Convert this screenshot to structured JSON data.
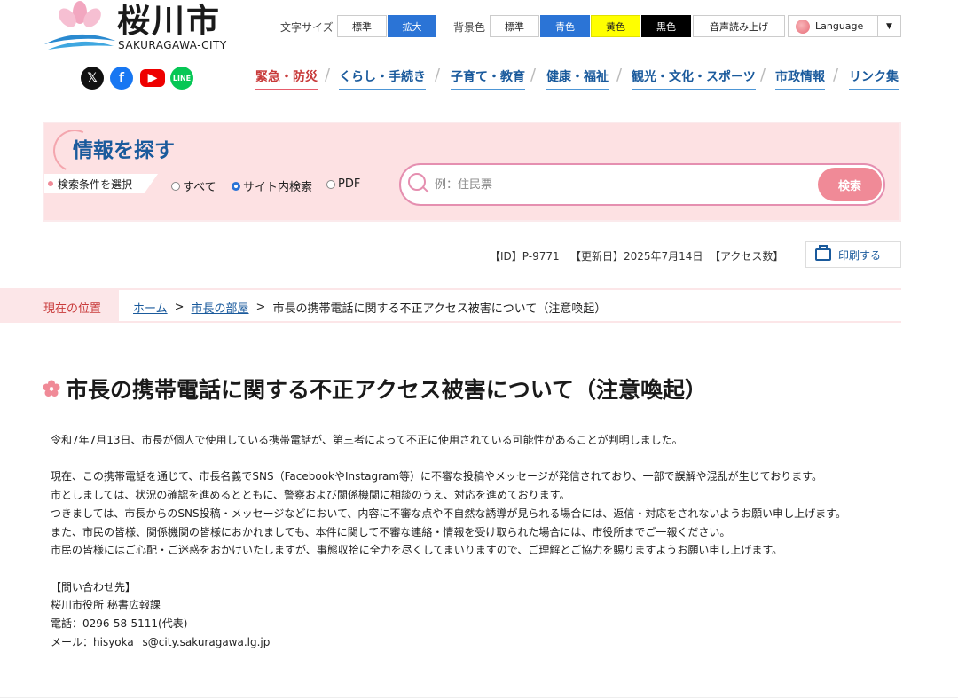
{
  "header": {
    "logo_title": "桜川市",
    "logo_sub": "SAKURAGAWA-CITY",
    "font_size_label": "文字サイズ",
    "font_size_buttons": [
      "標準",
      "拡大"
    ],
    "bg_color_label": "背景色",
    "bg_color_buttons": [
      "標準",
      "青色",
      "黄色",
      "黒色"
    ],
    "read_aloud": "音声読み上げ",
    "language": "Language",
    "social": [
      "x-icon",
      "facebook-icon",
      "youtube-icon",
      "line-icon"
    ],
    "global_nav": [
      "緊急・防災",
      "くらし・手続き",
      "子育て・教育",
      "健康・福祉",
      "観光・文化・スポーツ",
      "市政情報",
      "リンク集"
    ]
  },
  "search": {
    "title": "情報を探す",
    "cond_label": "検索条件を選択",
    "options": [
      "すべて",
      "サイト内検索",
      "PDF"
    ],
    "selected": "サイト内検索",
    "placeholder": "例：住民票",
    "button": "検索"
  },
  "meta": {
    "id": "【ID】P-9771",
    "updated": "【更新日】2025年7月14日",
    "access": "【アクセス数】",
    "print": "印刷する"
  },
  "breadcrumb": {
    "label": "現在の位置",
    "items": [
      "ホーム",
      "市長の部屋"
    ],
    "current": "市長の携帯電話に関する不正アクセス被害について（注意喚起）",
    "separator": ">"
  },
  "article": {
    "title": "市長の携帯電話に関する不正アクセス被害について（注意喚起）",
    "p1": "令和7年7月13日、市長が個人で使用している携帯電話が、第三者によって不正に使用されている可能性があることが判明しました。",
    "p2": "現在、この携帯電話を通じて、市長名義でSNS（FacebookやInstagram等）に不審な投稿やメッセージが発信されており、一部で誤解や混乱が生じております。",
    "p3": "市としましては、状況の確認を進めるとともに、警察および関係機関に相談のうえ、対応を進めております。",
    "p4": "つきましては、市長からのSNS投稿・メッセージなどにおいて、内容に不審な点や不自然な誘導が見られる場合には、返信・対応をされないようお願い申し上げます。",
    "p5": "また、市民の皆様、関係機関の皆様におかれましても、本件に関して不審な連絡・情報を受け取られた場合には、市役所までご一報ください。",
    "p6": "市民の皆様にはご心配・ご迷惑をおかけいたしますが、事態収拾に全力を尽くしてまいりますので、ご理解とご協力を賜りますようお願い申し上げます。",
    "contact_heading": "【問い合わせ先】",
    "contact_org": "桜川市役所 秘書広報課",
    "contact_tel": "電話：0296-58-5111(代表)",
    "contact_mail": "メール：hisyoka _s@city.sakuragawa.lg.jp"
  },
  "colors": {
    "accent_blue": "#1a5a9c",
    "pink": "#f08a97",
    "emergency_red": "#c83a3a"
  }
}
